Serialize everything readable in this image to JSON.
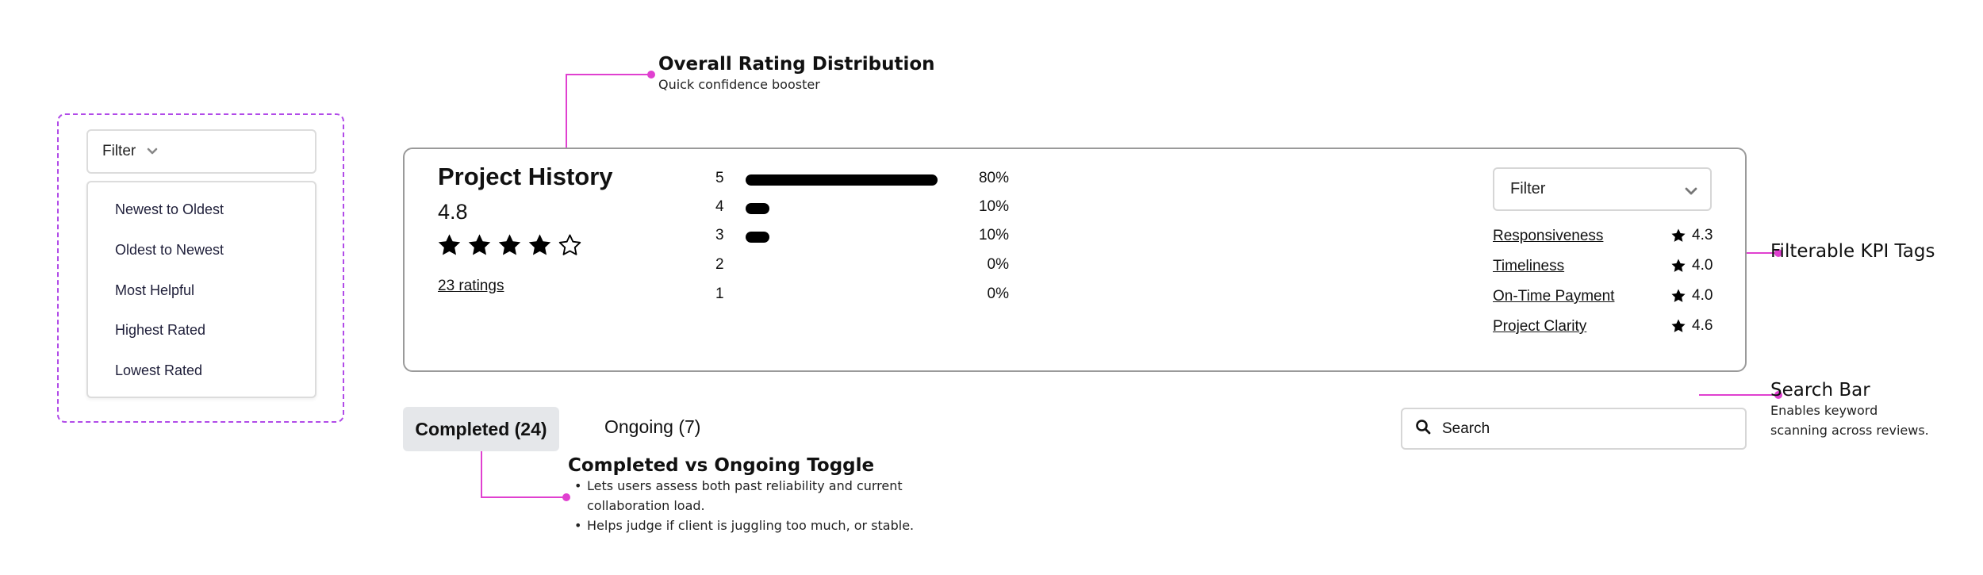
{
  "sort_dropdown": {
    "label": "Filter",
    "options": [
      "Newest to Oldest",
      "Oldest to Newest",
      "Most Helpful",
      "Highest Rated",
      "Lowest Rated"
    ]
  },
  "summary": {
    "title": "Project History",
    "average": "4.8",
    "stars_filled": 4,
    "stars_total": 5,
    "ratings_link": "23 ratings"
  },
  "distribution": [
    {
      "label": "5",
      "pct_text": "80%",
      "fill": 1.0
    },
    {
      "label": "4",
      "pct_text": "10%",
      "fill": 0.125
    },
    {
      "label": "3",
      "pct_text": "10%",
      "fill": 0.125
    },
    {
      "label": "2",
      "pct_text": "0%",
      "fill": 0
    },
    {
      "label": "1",
      "pct_text": "0%",
      "fill": 0
    }
  ],
  "kpi_filter": {
    "label": "Filter"
  },
  "kpis": [
    {
      "name": "Responsiveness",
      "score": "4.3"
    },
    {
      "name": "Timeliness",
      "score": "4.0"
    },
    {
      "name": "On-Time Payment",
      "score": "4.0"
    },
    {
      "name": "Project Clarity",
      "score": "4.6"
    }
  ],
  "tabs": {
    "completed": "Completed (24)",
    "ongoing": "Ongoing (7)"
  },
  "search": {
    "placeholder": "Search"
  },
  "annotations": {
    "distribution": {
      "title": "Overall Rating Distribution",
      "subtitle": "Quick confidence booster"
    },
    "kpi": {
      "title": "Filterable KPI Tags"
    },
    "search": {
      "title": "Search Bar",
      "line1": "Enables keyword",
      "line2": "scanning across reviews."
    },
    "toggle": {
      "title": "Completed vs Ongoing Toggle",
      "bullet1_line1": "Lets users assess both past reliability and current",
      "bullet1_line2": "collaboration load.",
      "bullet2": "Helps judge if client is juggling too much, or stable."
    }
  },
  "colors": {
    "annotation_line": "#e040d0",
    "dashed_frame": "#b14be8",
    "bar_fill": "#000000",
    "tab_active_bg": "#e5e7ea"
  },
  "icons": {
    "chevron": "chevron-down-icon",
    "star_filled": "star-filled-icon",
    "star_outline": "star-outline-icon",
    "search": "search-icon"
  }
}
